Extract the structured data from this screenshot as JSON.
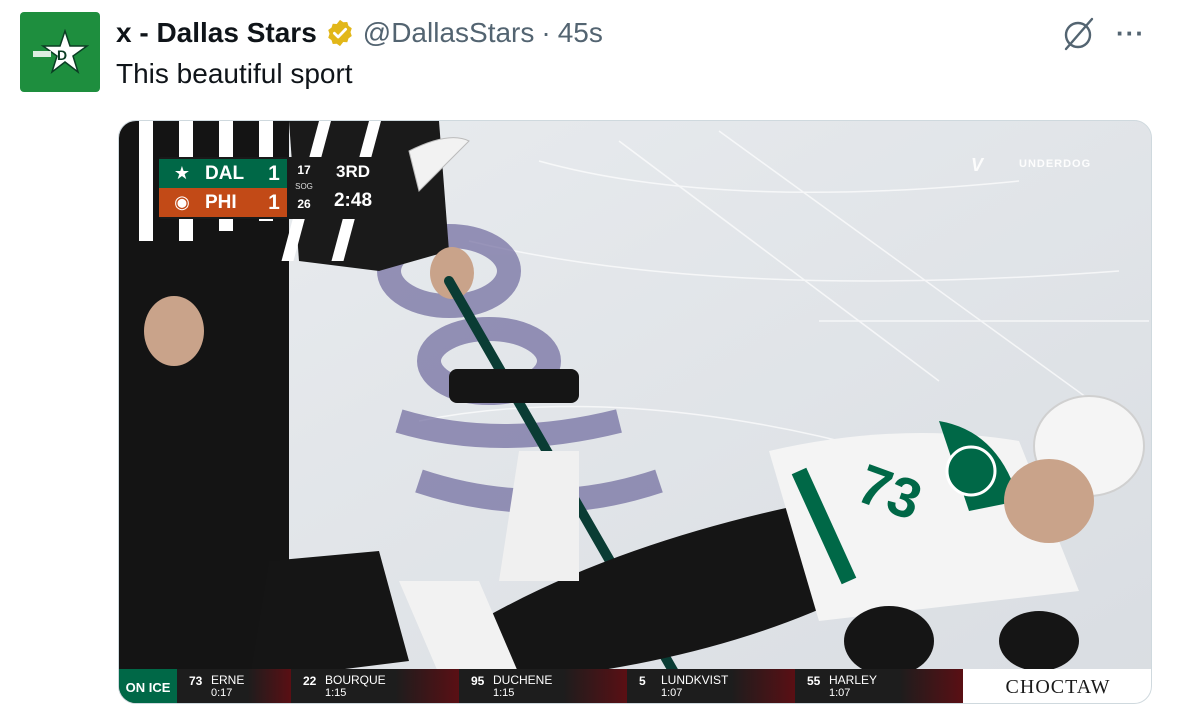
{
  "tweet": {
    "display_name": "x - Dallas Stars",
    "handle": "@DallasStars",
    "separator": "·",
    "time": "45s",
    "text": "This beautiful sport",
    "avatar_icon": "dallas-stars-logo-icon",
    "verified_icon": "verified-badge-icon",
    "grok_icon": "grok-icon",
    "more_label": "···",
    "colors": {
      "brand_green": "#006847",
      "avatar_green": "#1e8e3e",
      "verified_gold": "#e2b719",
      "secondary_text": "#536471"
    }
  },
  "video": {
    "scorebug": {
      "home": {
        "team": "DAL",
        "score": "1",
        "sog": "17"
      },
      "away": {
        "team": "PHI",
        "score": "1",
        "sog": "26"
      },
      "sog_label": "SOG",
      "period": "3RD",
      "clock": "2:48"
    },
    "broadcast_brand": "V",
    "sponsor_top": "UNDERDOG",
    "player_jersey_number": "73",
    "on_ice": {
      "label": "ON ICE",
      "players": [
        {
          "number": "73",
          "name": "ERNE",
          "toi": "0:17"
        },
        {
          "number": "22",
          "name": "BOURQUE",
          "toi": "1:15"
        },
        {
          "number": "95",
          "name": "DUCHENE",
          "toi": "1:15"
        },
        {
          "number": "5",
          "name": "LUNDKVIST",
          "toi": "1:07"
        },
        {
          "number": "55",
          "name": "HARLEY",
          "toi": "1:07"
        }
      ],
      "sponsor": "CHOCTAW"
    }
  }
}
